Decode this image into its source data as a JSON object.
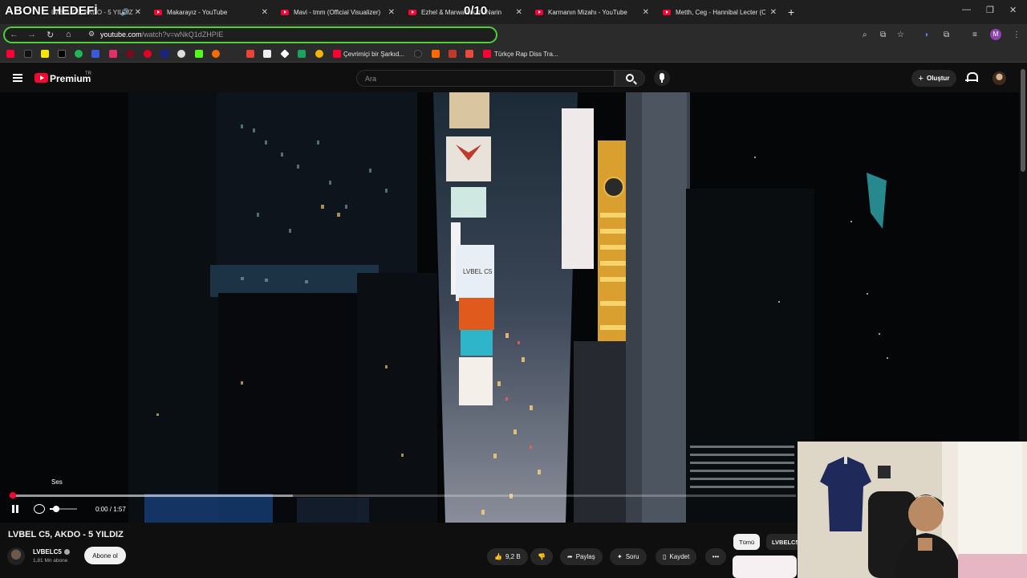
{
  "overlay": {
    "title": "ABONE HEDEFİ",
    "counter": "0/10"
  },
  "browser": {
    "tabs": [
      {
        "title": "LVBEL C5, AKDO - 5 YILDIZ",
        "playing": true
      },
      {
        "title": "Makarayız - YouTube"
      },
      {
        "title": "Mavi - tmm (Official Visualizer)"
      },
      {
        "title": "Ezhel & Marwa Loud - Narin"
      },
      {
        "title": "Karmanın Mizahı - YouTube"
      },
      {
        "title": "Metth, Ceg - Hannibal Lecter (Of"
      }
    ],
    "address": {
      "domain": "youtube.com",
      "path": "/watch?v=wNkQ1dZHPIE"
    },
    "bookmarks": [
      {
        "label": "Çevrimiçi bir Şarkıd..."
      },
      {
        "label": "Türkçe Rap Diss Tra..."
      }
    ],
    "profile_initial": "M"
  },
  "youtube": {
    "brand": "Premium",
    "region": "TR",
    "search_placeholder": "Ara",
    "create_label": "Oluştur",
    "player": {
      "tooltip": "Ses",
      "time": "0:00 / 1:57",
      "progress": 0.0,
      "buffered": 0.36,
      "volume": 0.25,
      "billboard_text": "LVBEL C5"
    },
    "video": {
      "title": "LVBEL C5, AKDO - 5 YILDIZ",
      "channel": "LVBELC5",
      "subscribers": "1,81 Mn abone",
      "subscribe_label": "Abone ol",
      "likes": "9,2 B",
      "share_label": "Paylaş",
      "ask_label": "Soru",
      "save_label": "Kaydet"
    },
    "chips": [
      {
        "label": "Tümü",
        "selected": true
      },
      {
        "label": "LVBELC5",
        "selected": false
      }
    ]
  },
  "colors": {
    "accent": "#ff0033",
    "highlight_border": "#4cd137",
    "background": "#0f0f0f"
  }
}
